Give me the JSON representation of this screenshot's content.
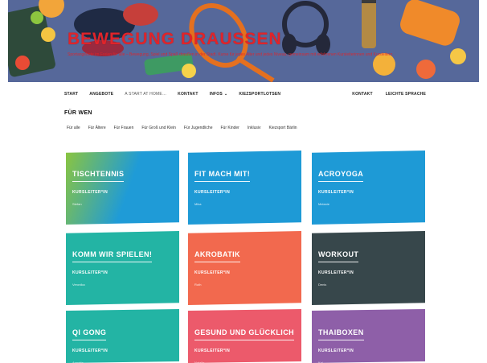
{
  "hero": {
    "title": "BEWEGUNG DRAUSSEN",
    "subtitle": "Sportangebote im Freien für alle – Bewegung, Spiel und Spaß draußen in der Stadt. Kurse für jedes Alter und jedes Niveau, gemeinsam mit erfahrenen Kursleiterinnen und Kursleitern."
  },
  "nav": {
    "left": [
      {
        "label": "Start",
        "muted": false
      },
      {
        "label": "Angebote",
        "muted": false
      },
      {
        "label": "A Start at Home…",
        "muted": true
      },
      {
        "label": "Kontakt",
        "muted": false
      },
      {
        "label": "Infos",
        "muted": false,
        "dropdown": true
      },
      {
        "label": "Kiezsportlotsen",
        "muted": false
      }
    ],
    "right": [
      {
        "label": "Kontakt"
      },
      {
        "label": "Leichte Sprache"
      }
    ]
  },
  "filter": {
    "title": "FÜR WEN",
    "items": [
      "Für alle",
      "Für Ältere",
      "Für Frauen",
      "Für Groß und Klein",
      "Für Jugendliche",
      "Für Kinder",
      "Inklusiv",
      "Kiezsport Bärlin"
    ]
  },
  "cards": [
    {
      "title": "TISCHTENNIS",
      "role": "KURSLEITER*IN",
      "name": "Stefan",
      "color": "#1f9bd7",
      "color2": "#8bc53f",
      "gradient": true
    },
    {
      "title": "FIT MACH MIT!",
      "role": "KURSLEITER*IN",
      "name": "Mika",
      "color": "#1e9ad6"
    },
    {
      "title": "ACROYOGA",
      "role": "KURSLEITER*IN",
      "name": "Melanie",
      "color": "#1e9ad6"
    },
    {
      "title": "KOMM WIR SPIELEN!",
      "role": "KURSLEITER*IN",
      "name": "Veronika",
      "color": "#23b4a4"
    },
    {
      "title": "AKROBATIK",
      "role": "KURSLEITER*IN",
      "name": "Ruth",
      "color": "#f2694e"
    },
    {
      "title": "WORKOUT",
      "role": "KURSLEITER*IN",
      "name": "Denis",
      "color": "#37474b"
    },
    {
      "title": "QI GONG",
      "role": "KURSLEITER*IN",
      "name": "Annette",
      "color": "#23b4a4"
    },
    {
      "title": "GESUND UND GLÜCKLICH",
      "role": "KURSLEITER*IN",
      "name": "Natalie",
      "color": "#ec5a6b"
    },
    {
      "title": "THAIBOXEN",
      "role": "KURSLEITER*IN",
      "name": "Kai",
      "color": "#8e5fa8"
    }
  ]
}
